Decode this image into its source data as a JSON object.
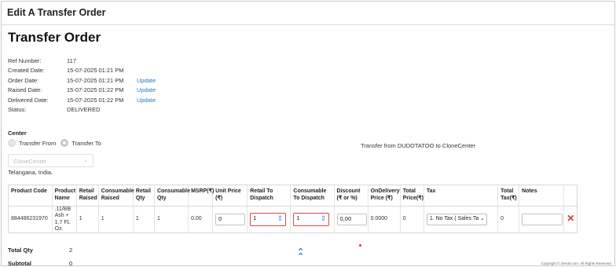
{
  "header": {
    "title": "Edit A Transfer Order"
  },
  "page_title": "Transfer Order",
  "info": [
    {
      "label": "Ref Number:",
      "value": "117",
      "link": ""
    },
    {
      "label": "Created Date:",
      "value": "15-07-2025 01:21 PM",
      "link": ""
    },
    {
      "label": "Order Date:",
      "value": "15-07-2025 01:21 PM",
      "link": "Update"
    },
    {
      "label": "Raised Date:",
      "value": "15-07-2025 01:22 PM",
      "link": "Update"
    },
    {
      "label": "Delivered Date:",
      "value": "15-07-2025 01:22 PM",
      "link": "Update"
    },
    {
      "label": "Status:",
      "value": "DELIVERED",
      "link": ""
    }
  ],
  "center": {
    "label": "Center",
    "transfer_from": "Transfer From",
    "transfer_to": "Transfer To",
    "selected_radio": "Transfer To",
    "select_value": "CloneCenter",
    "location": "Telangana, India.",
    "transfer_note": "Transfer from DUDOTATOO to CloneCenter"
  },
  "table": {
    "headers": {
      "product_code": "Product Code",
      "product_name": "Product Name",
      "retail_raised": "Retail Raised",
      "consumable_raised": "Consumable Raised",
      "retail_qty": "Retail Qty",
      "consumable_qty": "Consumable Qty",
      "msrp": "MSRP(₹)",
      "unit_price": "Unit Price (₹)",
      "retail_dispatch": "Retail To Dispatch",
      "consumable_dispatch": "Consumable To Dispatch",
      "discount": "Discount (₹ or %)",
      "ondelivery": "OnDelivery Price (₹)",
      "total_price": "Total Price(₹)",
      "tax": "Tax",
      "total_tax": "Total Tax(₹)",
      "notes": "Notes"
    },
    "row": {
      "product_code": "884486231970",
      "product_name": ".11/BB Ash + 1.7 FL Oz.",
      "retail_raised": "1",
      "consumable_raised": "1",
      "retail_qty": "1",
      "consumable_qty": "1",
      "msrp": "0.00",
      "unit_price": "0",
      "retail_dispatch": "1",
      "consumable_dispatch": "1",
      "discount": "0,00",
      "ondelivery": "0.0000",
      "total_price": "0",
      "tax": "1. No Tax ( Sales Tax",
      "total_tax": "0",
      "notes": ""
    }
  },
  "totals": [
    {
      "label": "Total Qty",
      "value": "2"
    },
    {
      "label": "Subtotal",
      "value": "0"
    }
  ],
  "footer": {
    "copyright": "Copyright © Zenoti.com. All Rights Reserved."
  },
  "icons": {
    "delete": "close-icon",
    "scroll_up": "double-chevron-up-icon",
    "spinner": "stepper-icon"
  },
  "colors": {
    "link": "#2a78c2",
    "error_border": "#e0454b",
    "delete": "#e0333a"
  }
}
